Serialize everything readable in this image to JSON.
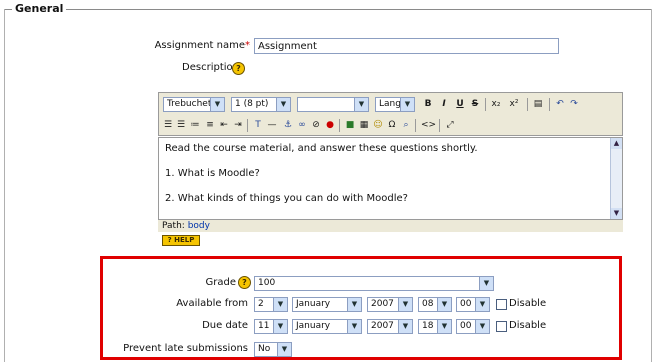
{
  "section": {
    "legend": "General"
  },
  "assignment_name": {
    "label": "Assignment name",
    "required_mark": "*",
    "value": "Assignment"
  },
  "description": {
    "label": "Description",
    "required_mark": "*",
    "help_icon": "help-icon"
  },
  "editor": {
    "font_family": "Trebuchet",
    "font_size": "1 (8 pt)",
    "style": "",
    "language": "Lang",
    "format_buttons": [
      "B",
      "I",
      "U",
      "S",
      "x₂",
      "x²"
    ],
    "content": [
      "Read the course material, and answer these questions shortly.",
      "1. What is Moodle?",
      "2. What kinds of things you can do with Moodle?"
    ],
    "path_label": "Path:",
    "path_value": "body"
  },
  "help_button_label": "? HELP",
  "grade": {
    "label": "Grade",
    "value": "100"
  },
  "available_from": {
    "label": "Available from",
    "day": "2",
    "month": "January",
    "year": "2007",
    "hour": "08",
    "minute": "00",
    "disable_label": "Disable"
  },
  "due_date": {
    "label": "Due date",
    "day": "11",
    "month": "January",
    "year": "2007",
    "hour": "18",
    "minute": "00",
    "disable_label": "Disable"
  },
  "prevent_late": {
    "label": "Prevent late submissions",
    "value": "No"
  },
  "colors": {
    "highlight": "#e00000",
    "help_yellow": "#f5c400",
    "field_border": "#8c9ec1"
  }
}
